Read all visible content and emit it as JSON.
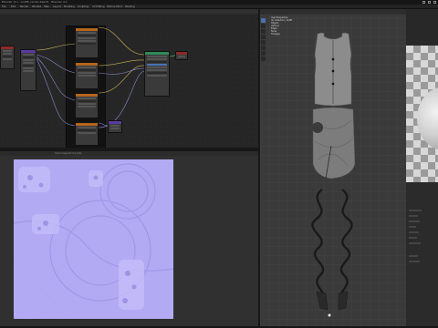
{
  "window": {
    "title": "Blender [C:\\...\\outfit_render.blend] - Blender 4.1"
  },
  "menubar": {
    "items": [
      "File",
      "Edit",
      "Render",
      "Window",
      "Help",
      "Layout",
      "Modeling",
      "Sculpting",
      "UV Editing",
      "Texture Paint",
      "Shading"
    ]
  },
  "node_editor": {
    "frame_label": "Textures"
  },
  "image_editor": {
    "header_text": "View  Image  Normal_Map"
  },
  "viewport": {
    "hud_lines": [
      "User Perspective",
      "(1) Collection | Outfit",
      "Objects",
      "Vertices",
      "Edges",
      "Faces",
      "Triangles"
    ]
  },
  "properties": {},
  "colors": {
    "accent": "#4772b3",
    "node_shader": "#2e8b57",
    "node_texture": "#b5651d",
    "node_input": "#8a2a2a",
    "normal_map": "#b3aaf4"
  }
}
